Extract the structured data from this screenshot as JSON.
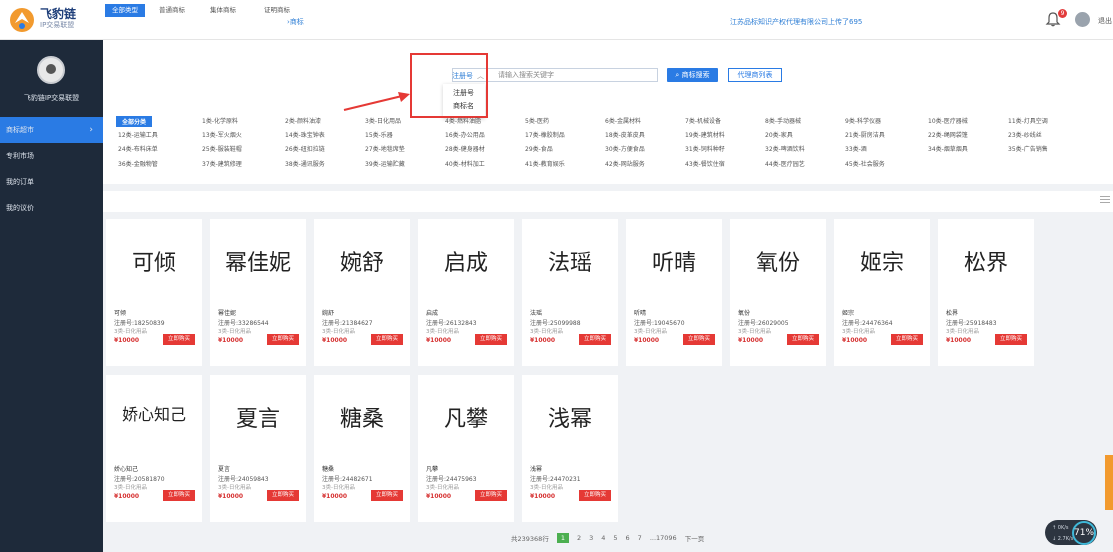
{
  "header": {
    "logo_title": "飞豹链",
    "logo_sub": "IP交易联盟",
    "center_link": "商标",
    "news": "江苏品标知识产权代理有限公司上传了695",
    "notify_count": "9",
    "logout": "退出"
  },
  "sidebar": {
    "org_name": "飞豹链IP交易联盟",
    "items": [
      {
        "label": "商标超市",
        "active": true
      },
      {
        "label": "专利市场"
      },
      {
        "label": "我的订单"
      },
      {
        "label": "我的议价"
      }
    ]
  },
  "search": {
    "type_selected": "注册号",
    "placeholder": "请输入搜索关键字",
    "search_button": "商标搜索",
    "agent_button": "代理商列表",
    "dropdown_options": [
      "注册号",
      "商标名"
    ]
  },
  "categories": [
    "全部分类",
    "1类-化学原料",
    "2类-颜料油漆",
    "3类-日化用品",
    "4类-燃料油脂",
    "5类-医药",
    "6类-金属材料",
    "7类-机械设备",
    "8类-手动器械",
    "9类-科学仪器",
    "10类-医疗器械",
    "11类-灯具空调",
    "12类-运输工具",
    "13类-军火烟火",
    "14类-珠宝钟表",
    "15类-乐器",
    "16类-办公用品",
    "17类-橡胶制品",
    "18类-皮革皮具",
    "19类-建筑材料",
    "20类-家具",
    "21类-厨房洁具",
    "22类-绳网袋篷",
    "23类-纱线丝",
    "24类-布料床单",
    "25类-服装鞋帽",
    "26类-纽扣拉链",
    "27类-地毯席垫",
    "28类-健身器材",
    "29类-食品",
    "30类-方便食品",
    "31类-饲料种籽",
    "32类-啤酒饮料",
    "33类-酒",
    "34类-烟草烟具",
    "35类-广告销售",
    "36类-金融物管",
    "37类-建筑修理",
    "38类-通讯服务",
    "39类-运输贮藏",
    "40类-材料加工",
    "41类-教育娱乐",
    "42类-网站服务",
    "43类-餐饮住宿",
    "44类-医疗园艺",
    "45类-社会服务"
  ],
  "tabs": [
    "全部类型",
    "普通商标",
    "集体商标",
    "证明商标"
  ],
  "cards": [
    {
      "mark": "可倾",
      "name": "可倾",
      "reg": "注册号:18250839",
      "cls": "3类-日化用品",
      "price": "¥10000",
      "buy": "立即购买"
    },
    {
      "mark": "幂佳妮",
      "name": "幂佳妮",
      "reg": "注册号:33286544",
      "cls": "3类-日化用品",
      "price": "¥10000",
      "buy": "立即购买"
    },
    {
      "mark": "婉舒",
      "name": "婉舒",
      "reg": "注册号:21384627",
      "cls": "3类-日化用品",
      "price": "¥10000",
      "buy": "立即购买"
    },
    {
      "mark": "启成",
      "name": "启成",
      "reg": "注册号:26132843",
      "cls": "3类-日化用品",
      "price": "¥10000",
      "buy": "立即购买"
    },
    {
      "mark": "法瑶",
      "name": "法瑶",
      "reg": "注册号:25099988",
      "cls": "3类-日化用品",
      "price": "¥10000",
      "buy": "立即购买"
    },
    {
      "mark": "听晴",
      "name": "听晴",
      "reg": "注册号:19045670",
      "cls": "3类-日化用品",
      "price": "¥10000",
      "buy": "立即购买"
    },
    {
      "mark": "氧份",
      "name": "氧份",
      "reg": "注册号:26029005",
      "cls": "3类-日化用品",
      "price": "¥10000",
      "buy": "立即购买"
    },
    {
      "mark": "姬宗",
      "name": "姬宗",
      "reg": "注册号:24476364",
      "cls": "3类-日化用品",
      "price": "¥10000",
      "buy": "立即购买"
    },
    {
      "mark": "松界",
      "name": "松界",
      "reg": "注册号:25918483",
      "cls": "3类-日化用品",
      "price": "¥10000",
      "buy": "立即购买"
    },
    {
      "mark": "娇心知己",
      "name": "娇心知己",
      "reg": "注册号:20581870",
      "cls": "3类-日化用品",
      "price": "¥10000",
      "buy": "立即购买"
    },
    {
      "mark": "夏言",
      "name": "夏言",
      "reg": "注册号:24059843",
      "cls": "3类-日化用品",
      "price": "¥10000",
      "buy": "立即购买"
    },
    {
      "mark": "糖桑",
      "name": "糖桑",
      "reg": "注册号:24482671",
      "cls": "3类-日化用品",
      "price": "¥10000",
      "buy": "立即购买"
    },
    {
      "mark": "凡攀",
      "name": "凡攀",
      "reg": "注册号:24475963",
      "cls": "3类-日化用品",
      "price": "¥10000",
      "buy": "立即购买"
    },
    {
      "mark": "浅幂",
      "name": "浅幂",
      "reg": "注册号:24470231",
      "cls": "3类-日化用品",
      "price": "¥10000",
      "buy": "立即购买"
    }
  ],
  "pagination": {
    "total": "共239368行",
    "pages": [
      "1",
      "2",
      "3",
      "4",
      "5",
      "6",
      "7",
      "...17096"
    ],
    "next": "下一页"
  },
  "widget": {
    "up": "0K/s",
    "down": "2.7K/s",
    "percent": "71%"
  },
  "colors": {
    "accent": "#2a7be4",
    "sidebar": "#1e2a3a",
    "buy": "#e53935",
    "annotation": "#e53935"
  }
}
